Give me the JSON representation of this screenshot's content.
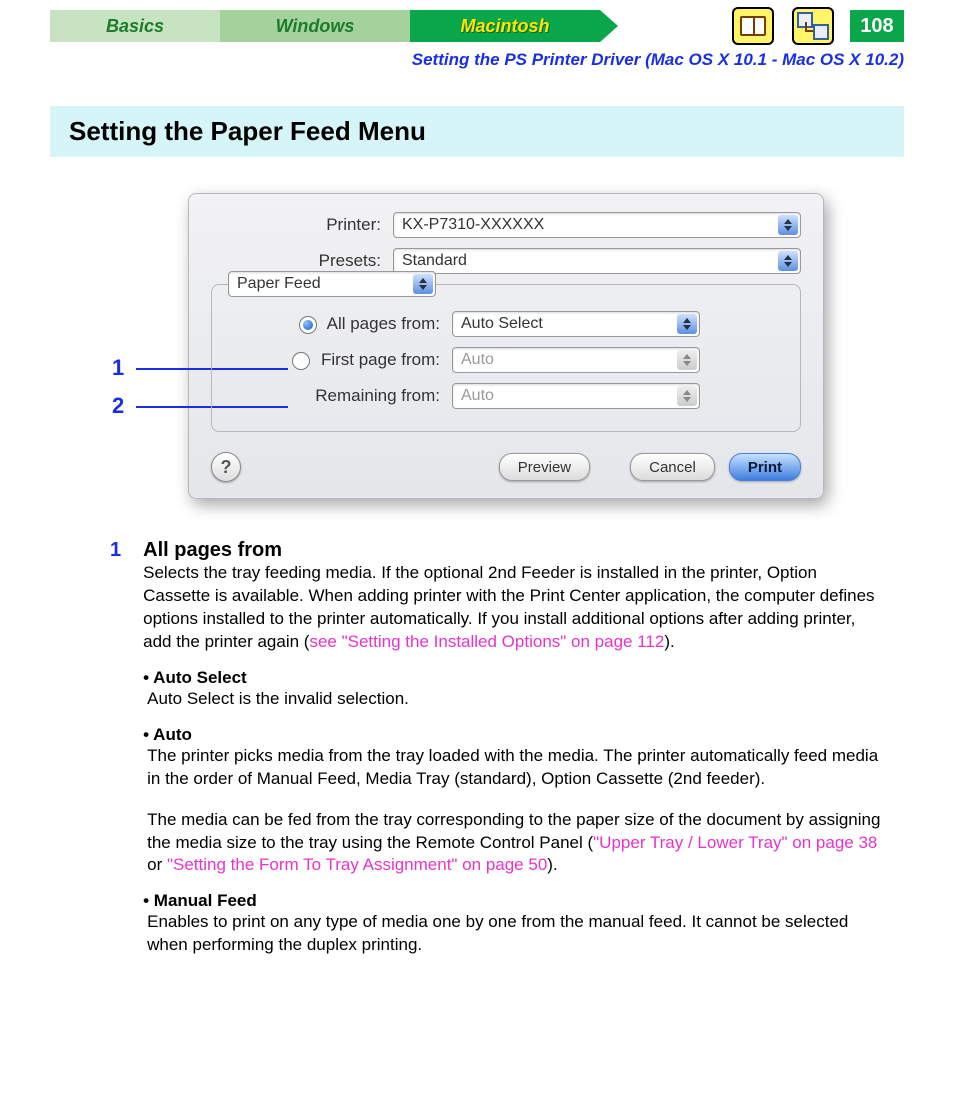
{
  "header": {
    "tabs": {
      "basics": "Basics",
      "windows": "Windows",
      "macintosh": "Macintosh"
    },
    "page_number": "108",
    "section_link": "Setting the PS Printer Driver (Mac OS X 10.1 - Mac OS X 10.2)"
  },
  "title": "Setting the Paper Feed Menu",
  "callouts": {
    "c1": "1",
    "c2": "2"
  },
  "dialog": {
    "printer_label": "Printer:",
    "printer_value": "KX-P7310-XXXXXX",
    "presets_label": "Presets:",
    "presets_value": "Standard",
    "pane_value": "Paper Feed",
    "allpages_label": "All pages from:",
    "allpages_value": "Auto Select",
    "firstpage_label": "First page from:",
    "firstpage_value": "Auto",
    "remaining_label": "Remaining from:",
    "remaining_value": "Auto",
    "help": "?",
    "preview_btn": "Preview",
    "cancel_btn": "Cancel",
    "print_btn": "Print"
  },
  "body": {
    "item1_num": "1",
    "item1_title": "All pages from",
    "item1_p1a": "Selects the tray feeding media. If the optional 2nd Feeder is installed in the printer, Option Cassette is available. When adding printer with the Print Center application, the computer defines options installed to the printer automatically. If you install additional options after adding printer, add the printer again (",
    "item1_link": "see \"Setting the Installed Options\" on page 112",
    "item1_p1b": ").",
    "b1_title": "• Auto Select",
    "b1_text": "Auto Select is the invalid selection.",
    "b2_title": "• Auto",
    "b2_text1": "The printer picks media from the tray loaded with the media. The printer automatically feed media in the order of Manual Feed, Media Tray (standard), Option Cassette (2nd feeder).",
    "b2_text2a": "The media can be fed from the tray corresponding to the paper size of the document by assigning the media size to the tray using the Remote Control Panel (",
    "b2_link1": "\"Upper Tray / Lower Tray\" on page 38",
    "b2_or": " or ",
    "b2_link2": "\"Setting the Form To Tray Assignment\" on page 50",
    "b2_text2b": ").",
    "b3_title": "• Manual Feed",
    "b3_text": "Enables to print on any type of media one by one from the manual feed. It cannot be selected when performing the duplex printing."
  }
}
